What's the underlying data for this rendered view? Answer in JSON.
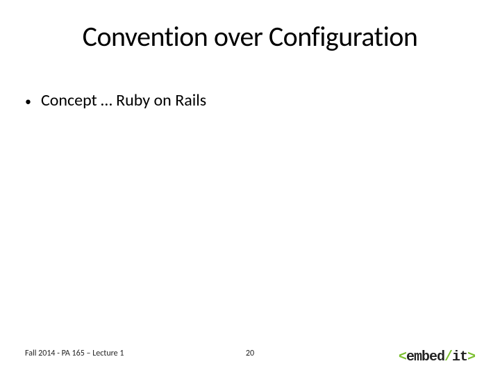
{
  "title": "Convention over Configuration",
  "bullets": [
    {
      "text": "Concept … Ruby on Rails"
    }
  ],
  "footer": {
    "left": "Fall 2014 - PA 165 – Lecture 1",
    "page": "20"
  },
  "logo": {
    "lt": "<",
    "word1": "embed",
    "slash": "/",
    "word2": "it",
    "gt": ">"
  }
}
